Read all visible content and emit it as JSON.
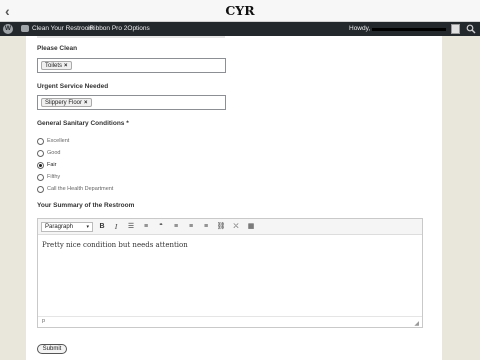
{
  "ios": {
    "title": "CYR",
    "back_icon": "chevron-left-icon"
  },
  "adminbar": {
    "site_name": "Clean Your Restroom",
    "plugin": "iRibbon Pro 2Options",
    "howdy": "Howdy,"
  },
  "form": {
    "please_clean_label": "Please Clean",
    "please_clean_tags": [
      "Toilets"
    ],
    "urgent_label": "Urgent Service Needed",
    "urgent_tags": [
      "Slippery Floor"
    ],
    "conditions_label": "General Sanitary Conditions *",
    "conditions_options": [
      "Excellent",
      "Good",
      "Fair",
      "Filthy",
      "Call the Health Department"
    ],
    "conditions_selected": "Fair",
    "summary_label": "Your Summary of the Restroom",
    "editor_format": "Paragraph",
    "editor_text": "Pretty nice condition but needs attention",
    "editor_path": "p",
    "submit_label": "Submit"
  },
  "colors": {
    "admin_bar": "#23282d",
    "page_bg": "#e9e6dc",
    "panel_bg": "#ffffff"
  }
}
